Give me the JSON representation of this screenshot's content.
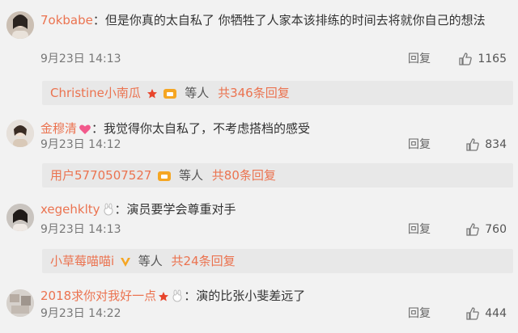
{
  "comments": [
    {
      "username": "7okbabe",
      "text": "：但是你真的太自私了 你牺牲了人家本该排练的时间去将就你自己的想法",
      "time": "9月23日 14:13",
      "reply_label": "回复",
      "likes": "1165",
      "avatar_icon": "avatar-portrait",
      "replies": {
        "names": "Christine小南瓜",
        "suffix": "等人",
        "count_text": "共346条回复"
      }
    },
    {
      "username": "金穆清",
      "text": "：我觉得你太自私了，不考虑搭档的感受",
      "time": "9月23日 14:12",
      "reply_label": "回复",
      "likes": "834",
      "avatar_icon": "avatar-portrait",
      "replies": {
        "names": "用户5770507527",
        "suffix": "等人",
        "count_text": "共80条回复"
      }
    },
    {
      "username": "xegehklty",
      "text": "：演员要学会尊重对手",
      "time": "9月23日 14:13",
      "reply_label": "回复",
      "likes": "760",
      "avatar_icon": "avatar-portrait",
      "replies": {
        "names": "小草莓喵喵i",
        "suffix": "等人",
        "count_text": "共24条回复"
      }
    },
    {
      "username": "2018求你对我好一点",
      "text": "：演的比张小斐差远了",
      "time": "9月23日 14:22",
      "reply_label": "回复",
      "likes": "444",
      "avatar_icon": "avatar-portrait"
    }
  ],
  "colors": {
    "accent": "#eb7350",
    "bg": "#f2f2f2",
    "reply_bg": "#e8e8e8"
  }
}
